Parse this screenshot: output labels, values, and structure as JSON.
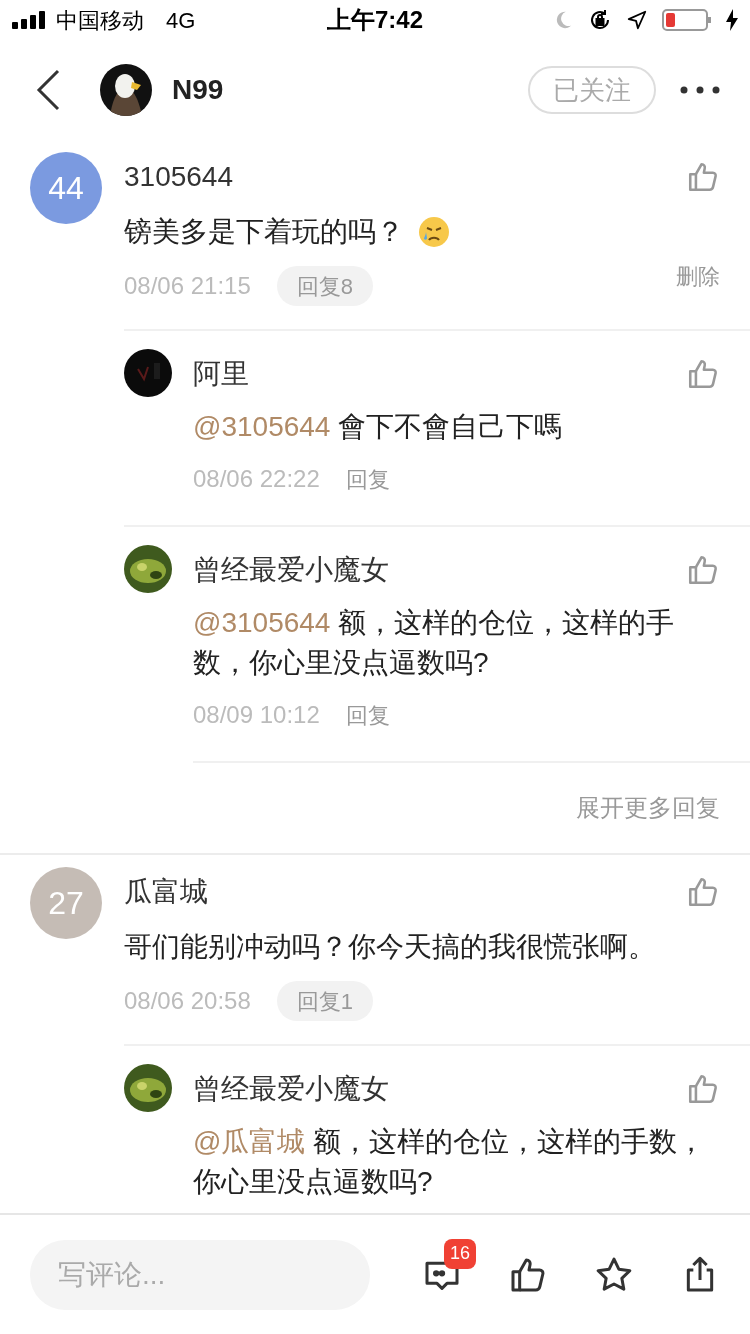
{
  "status_bar": {
    "carrier": "中国移动",
    "network": "4G",
    "time": "上午7:42"
  },
  "header": {
    "title": "N99",
    "follow_button": "已关注"
  },
  "comments": [
    {
      "avatar": {
        "kind": "number",
        "text": "44",
        "color": "#7b9ae0"
      },
      "name": "3105644",
      "text": "镑美多是下着玩的吗？",
      "has_emoji": true,
      "time": "08/06 21:15",
      "reply_count": "回复8",
      "delete_label": "删除",
      "replies": [
        {
          "name": "阿里",
          "mention": "@3105644",
          "text": "會下不會自己下嗎",
          "time": "08/06 22:22",
          "reply_label": "回复"
        },
        {
          "name": "曾经最爱小魔女",
          "mention": "@3105644",
          "text": "额，这样的仓位，这样的手数，你心里没点逼数吗?",
          "time": "08/09 10:12",
          "reply_label": "回复"
        }
      ],
      "more_replies": "展开更多回复"
    },
    {
      "avatar": {
        "kind": "number",
        "text": "27",
        "color": "#c5bcb5"
      },
      "name": "瓜富城",
      "text": "哥们能别冲动吗？你今天搞的我很慌张啊。",
      "has_emoji": false,
      "time": "08/06 20:58",
      "reply_count": "回复1",
      "replies": [
        {
          "name": "曾经最爱小魔女",
          "mention": "@瓜富城",
          "text": "额，这样的仓位，这样的手数，你心里没点逼数吗?"
        }
      ]
    }
  ],
  "bottom_bar": {
    "placeholder": "写评论...",
    "comment_count": "16"
  }
}
